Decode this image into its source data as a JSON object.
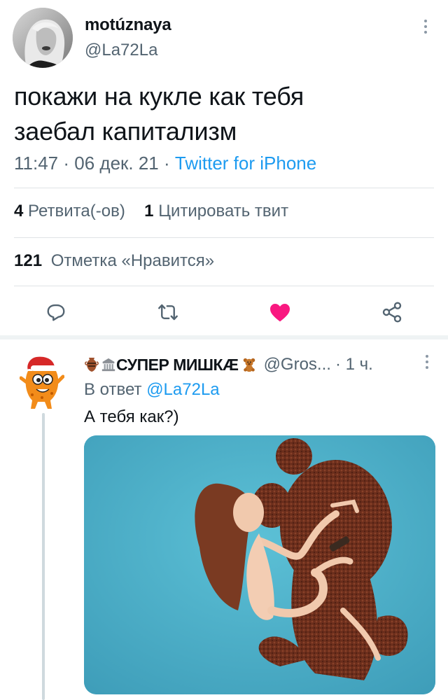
{
  "tweet": {
    "author": {
      "display_name": "motúznaya",
      "handle": "@La72La"
    },
    "text_line1": "покажи на кукле как тебя",
    "text_line2": "заебал капитализм",
    "time": "11:47",
    "sep1": " · ",
    "date": "06 дек. 21",
    "sep2": " · ",
    "source": "Twitter for iPhone",
    "stats": {
      "retweets_count": "4",
      "retweets_label": "Ретвита(-ов)",
      "quotes_count": "1",
      "quotes_label": "Цитировать твит",
      "likes_count": "121",
      "likes_label": "Отметка «Нравится»"
    },
    "actions": {
      "reply_icon": "reply-icon",
      "retweet_icon": "retweet-icon",
      "like_icon": "heart-filled-icon",
      "share_icon": "share-icon",
      "like_color": "#f91880"
    }
  },
  "reply": {
    "display_name": "СУПЕР МИШКÆ",
    "handle": "@Gros...",
    "time": "· 1 ч.",
    "reply_to_label": "В ответ",
    "reply_to_mention": "@La72La",
    "text": "А тебя как?)",
    "media_alt_icon": "photo-image"
  },
  "colors": {
    "accent": "#1d9bf0",
    "secondary_text": "#536471",
    "photo_bg": "#4aaec9"
  }
}
